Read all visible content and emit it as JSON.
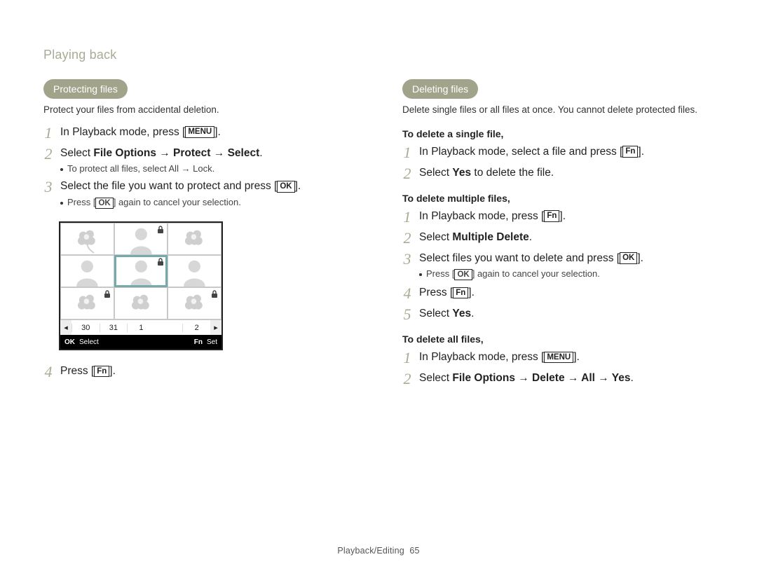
{
  "header": {
    "section_title": "Playing back"
  },
  "buttons": {
    "menu": "MENU",
    "ok": "OK",
    "fn": "Fn"
  },
  "left": {
    "pill": "Protecting files",
    "lead": "Protect your files from accidental deletion.",
    "steps": [
      {
        "num": "1",
        "segments": [
          {
            "t": "In Playback mode, press ["
          },
          {
            "btn": "menu"
          },
          {
            "t": "]."
          }
        ]
      },
      {
        "num": "2",
        "segments": [
          {
            "t": "Select "
          },
          {
            "t": "File Options → Protect → Select",
            "strong": true
          },
          {
            "t": "."
          }
        ],
        "note_segments": [
          {
            "t": "To protect all files, select "
          },
          {
            "t": "All → Lock",
            "strong": true
          },
          {
            "t": "."
          }
        ]
      },
      {
        "num": "3",
        "segments": [
          {
            "t": "Select the file you want to protect and press ["
          },
          {
            "btn": "ok"
          },
          {
            "t": "]."
          }
        ],
        "note_segments": [
          {
            "t": "Press ["
          },
          {
            "btn": "ok"
          },
          {
            "t": "] again to cancel your selection."
          }
        ]
      },
      {
        "num": "4",
        "segments": [
          {
            "t": "Press ["
          },
          {
            "btn": "fn"
          },
          {
            "t": "]."
          }
        ]
      }
    ],
    "shot": {
      "dates": [
        "30",
        "31",
        "1",
        "",
        "2"
      ],
      "status": {
        "ok": "OK",
        "ok_label": "Select",
        "fn": "Fn",
        "fn_label": "Set"
      }
    }
  },
  "right": {
    "pill": "Deleting files",
    "lead": "Delete single files or all files at once. You cannot delete protected files.",
    "groups": [
      {
        "title": "To delete a single file,",
        "steps": [
          {
            "num": "1",
            "segments": [
              {
                "t": "In Playback mode, select a file and press ["
              },
              {
                "btn": "fn"
              },
              {
                "t": "]."
              }
            ]
          },
          {
            "num": "2",
            "segments": [
              {
                "t": "Select "
              },
              {
                "t": "Yes",
                "strong": true
              },
              {
                "t": " to delete the file."
              }
            ]
          }
        ]
      },
      {
        "title": "To delete multiple files,",
        "steps": [
          {
            "num": "1",
            "segments": [
              {
                "t": "In Playback mode, press ["
              },
              {
                "btn": "fn"
              },
              {
                "t": "]."
              }
            ]
          },
          {
            "num": "2",
            "segments": [
              {
                "t": "Select "
              },
              {
                "t": "Multiple Delete",
                "strong": true
              },
              {
                "t": "."
              }
            ]
          },
          {
            "num": "3",
            "segments": [
              {
                "t": "Select files you want to delete and press ["
              },
              {
                "btn": "ok"
              },
              {
                "t": "]."
              }
            ],
            "note_segments": [
              {
                "t": "Press ["
              },
              {
                "btn": "ok"
              },
              {
                "t": "] again to cancel your selection."
              }
            ]
          },
          {
            "num": "4",
            "segments": [
              {
                "t": "Press ["
              },
              {
                "btn": "fn"
              },
              {
                "t": "]."
              }
            ]
          },
          {
            "num": "5",
            "segments": [
              {
                "t": "Select "
              },
              {
                "t": "Yes",
                "strong": true
              },
              {
                "t": "."
              }
            ]
          }
        ]
      },
      {
        "title": "To delete all files,",
        "steps": [
          {
            "num": "1",
            "segments": [
              {
                "t": "In Playback mode, press ["
              },
              {
                "btn": "menu"
              },
              {
                "t": "]."
              }
            ]
          },
          {
            "num": "2",
            "segments": [
              {
                "t": "Select "
              },
              {
                "t": "File Options → Delete → All → Yes",
                "strong": true
              },
              {
                "t": "."
              }
            ]
          }
        ]
      }
    ]
  },
  "footer": {
    "chapter": "Playback/Editing",
    "page": "65"
  }
}
